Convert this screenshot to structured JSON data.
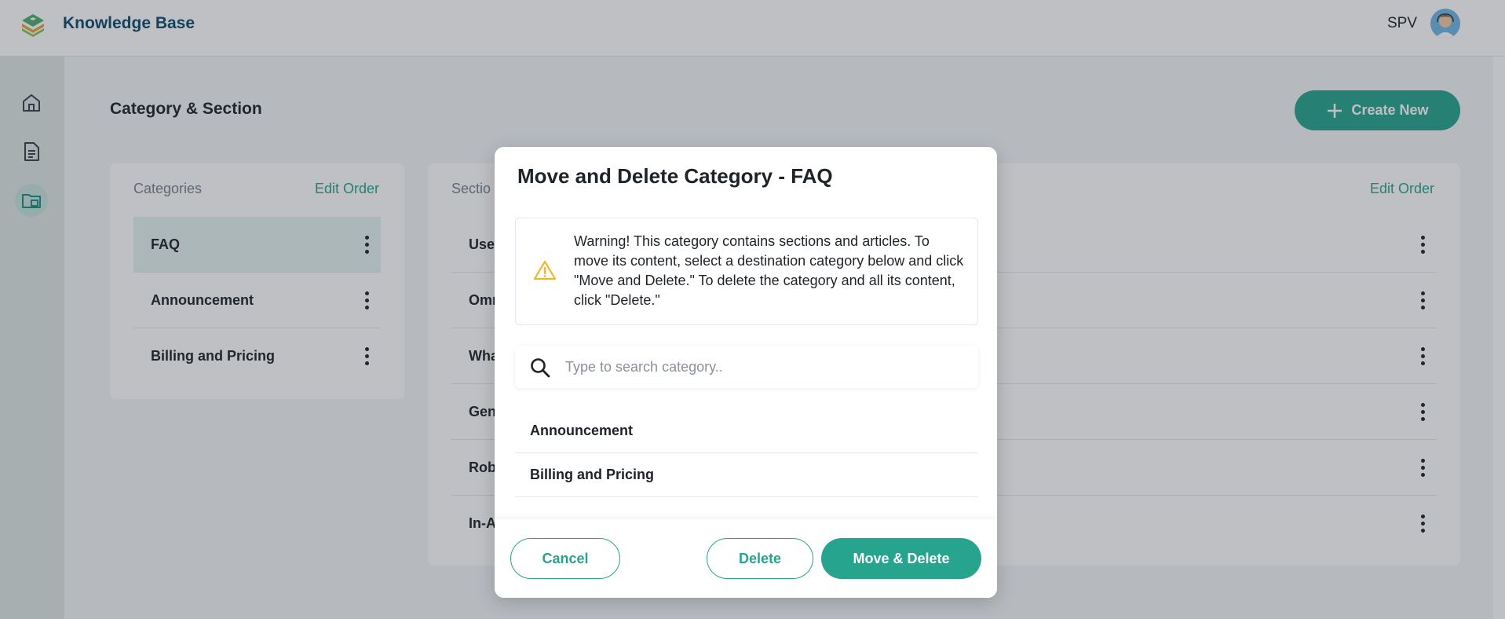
{
  "header": {
    "app_title": "Knowledge Base",
    "user_name": "SPV"
  },
  "sidebar": {
    "items": [
      {
        "icon": "home-icon"
      },
      {
        "icon": "document-icon"
      },
      {
        "icon": "folder-icon",
        "active": true
      }
    ]
  },
  "page": {
    "title": "Category & Section",
    "create_label": "Create New"
  },
  "categories": {
    "header": "Categories",
    "edit_order": "Edit Order",
    "items": [
      "FAQ",
      "Announcement",
      "Billing and Pricing"
    ]
  },
  "sections": {
    "header": "Sectio",
    "edit_order": "Edit Order",
    "items": [
      "Use",
      "Omr",
      "Wha",
      "Gen",
      "Rob",
      "In-A"
    ]
  },
  "modal": {
    "title": "Move and Delete Category - FAQ",
    "warning": "Warning! This category contains sections and articles. To move its content, select a destination category below and click \"Move and Delete.\" To delete the category and all its content, click \"Delete.\"",
    "search_placeholder": "Type to search category..",
    "options": [
      "Announcement",
      "Billing and Pricing"
    ],
    "cancel_label": "Cancel",
    "delete_label": "Delete",
    "move_delete_label": "Move & Delete"
  },
  "colors": {
    "accent": "#26a48d",
    "brand_text": "#0c4a6e",
    "warning": "#f0b429"
  }
}
